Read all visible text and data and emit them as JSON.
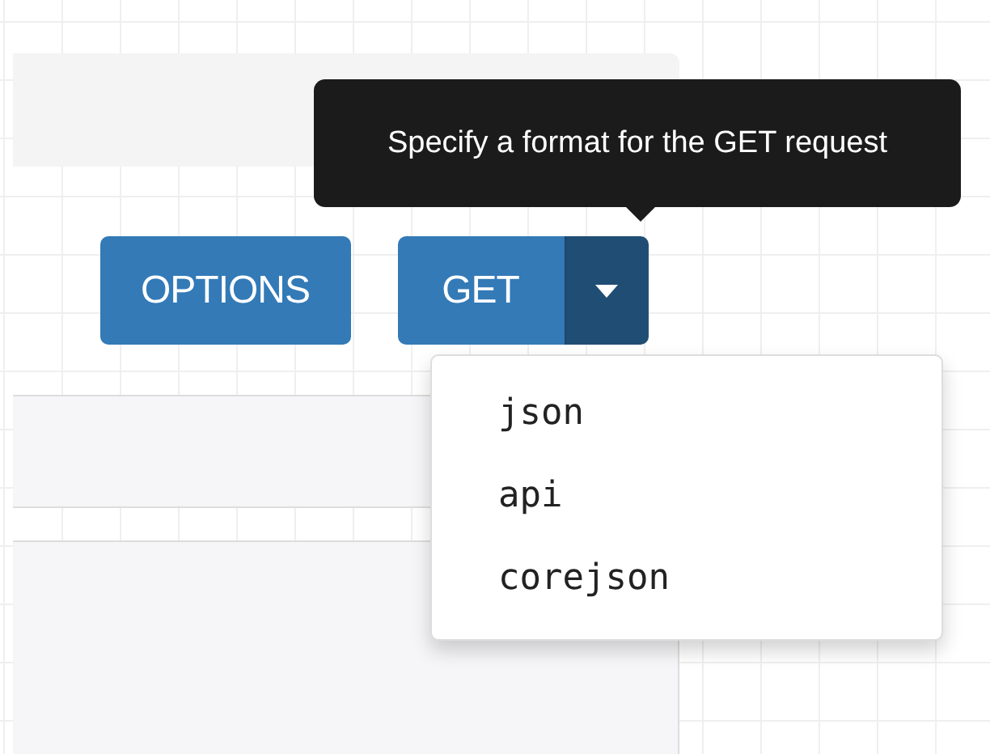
{
  "buttons": [
    {
      "label": "OPTIONS"
    },
    {
      "label": "GET"
    }
  ],
  "format_toggle": {
    "expanded": true
  },
  "tooltip": {
    "text": "Specify a format for the GET request"
  },
  "format_menu": {
    "items": [
      {
        "label": "json"
      },
      {
        "label": "api"
      },
      {
        "label": "corejson"
      }
    ]
  }
}
